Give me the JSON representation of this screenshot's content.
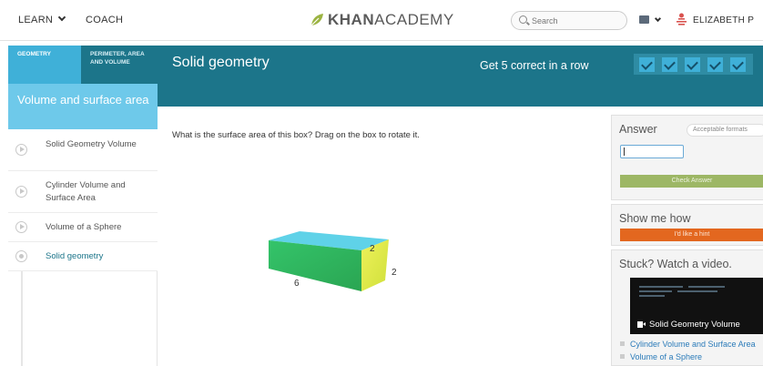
{
  "topnav": {
    "learn_label": "LEARN",
    "coach_label": "COACH",
    "logo_bold": "KHAN",
    "logo_light": "ACADEMY",
    "search_placeholder": "Search",
    "user_name": "ELIZABETH P"
  },
  "sidebar": {
    "tabs": [
      {
        "label": "GEOMETRY",
        "active": true
      },
      {
        "label": "PERIMETER, AREA AND VOLUME",
        "active": false
      }
    ],
    "section_title": "Volume and surface area",
    "items": [
      {
        "label": "Solid Geometry Volume",
        "icon": "video-play-icon"
      },
      {
        "label": "Cylinder Volume and Surface Area",
        "icon": "video-play-icon"
      },
      {
        "label": "Volume of a Sphere",
        "icon": "video-play-icon"
      },
      {
        "label": "Solid geometry",
        "icon": "exercise-dot-icon",
        "current": true
      }
    ]
  },
  "exercise": {
    "title": "Solid geometry",
    "streak_label": "Get 5 correct in a row",
    "streak_total": 5,
    "question": "What is the surface area of this box? Drag on the box to rotate it.",
    "box_dims": {
      "length": "6",
      "width": "2",
      "height": "2"
    }
  },
  "answer": {
    "title": "Answer",
    "formats_button": "Acceptable formats",
    "input_value": "",
    "check_button": "Check Answer"
  },
  "hint": {
    "title": "Show me how",
    "button": "I'd like a hint"
  },
  "video": {
    "title": "Stuck? Watch a video.",
    "thumb_label": "Solid Geometry Volume",
    "links": [
      "Cylinder Volume and Surface Area",
      "Volume of a Sphere"
    ]
  },
  "colors": {
    "header_teal": "#1c758a",
    "light_blue": "#3fb0d8",
    "section_blue": "#6ec9ea",
    "check_green": "#9db765",
    "hint_orange": "#e3671f",
    "logo_green": "#9cb443"
  }
}
